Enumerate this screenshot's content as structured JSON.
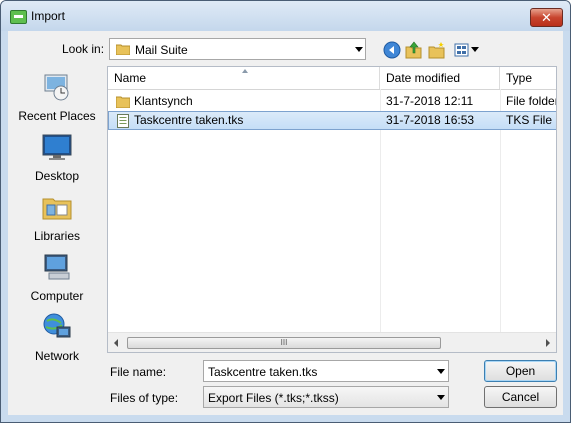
{
  "window": {
    "title": "Import",
    "close_glyph": "✕"
  },
  "toolbar": {
    "lookin_label": "Look in:",
    "lookin_value": "Mail Suite",
    "icons": [
      "back-icon",
      "up-folder-icon",
      "new-folder-icon",
      "view-menu-icon"
    ]
  },
  "places": [
    {
      "label": "Recent Places",
      "icon": "recent-places-icon"
    },
    {
      "label": "Desktop",
      "icon": "desktop-icon"
    },
    {
      "label": "Libraries",
      "icon": "libraries-icon"
    },
    {
      "label": "Computer",
      "icon": "computer-icon"
    },
    {
      "label": "Network",
      "icon": "network-icon"
    }
  ],
  "columns": {
    "name": "Name",
    "date": "Date modified",
    "type": "Type"
  },
  "files": [
    {
      "name": "Klantsynch",
      "date": "31-7-2018 12:11",
      "type": "File folder",
      "icon": "folder-icon",
      "selected": false
    },
    {
      "name": "Taskcentre taken.tks",
      "date": "31-7-2018 16:53",
      "type": "TKS File",
      "icon": "file-icon",
      "selected": true
    }
  ],
  "scroll": {
    "grip": "III"
  },
  "form": {
    "filename_label": "File name:",
    "filename_value": "Taskcentre taken.tks",
    "filetype_label": "Files of type:",
    "filetype_value": "Export Files (*.tks;*.tkss)"
  },
  "buttons": {
    "open": "Open",
    "cancel": "Cancel"
  },
  "colors": {
    "title_bg": "#c9dbee",
    "close": "#c8452e",
    "selection": "#cce4f7"
  }
}
